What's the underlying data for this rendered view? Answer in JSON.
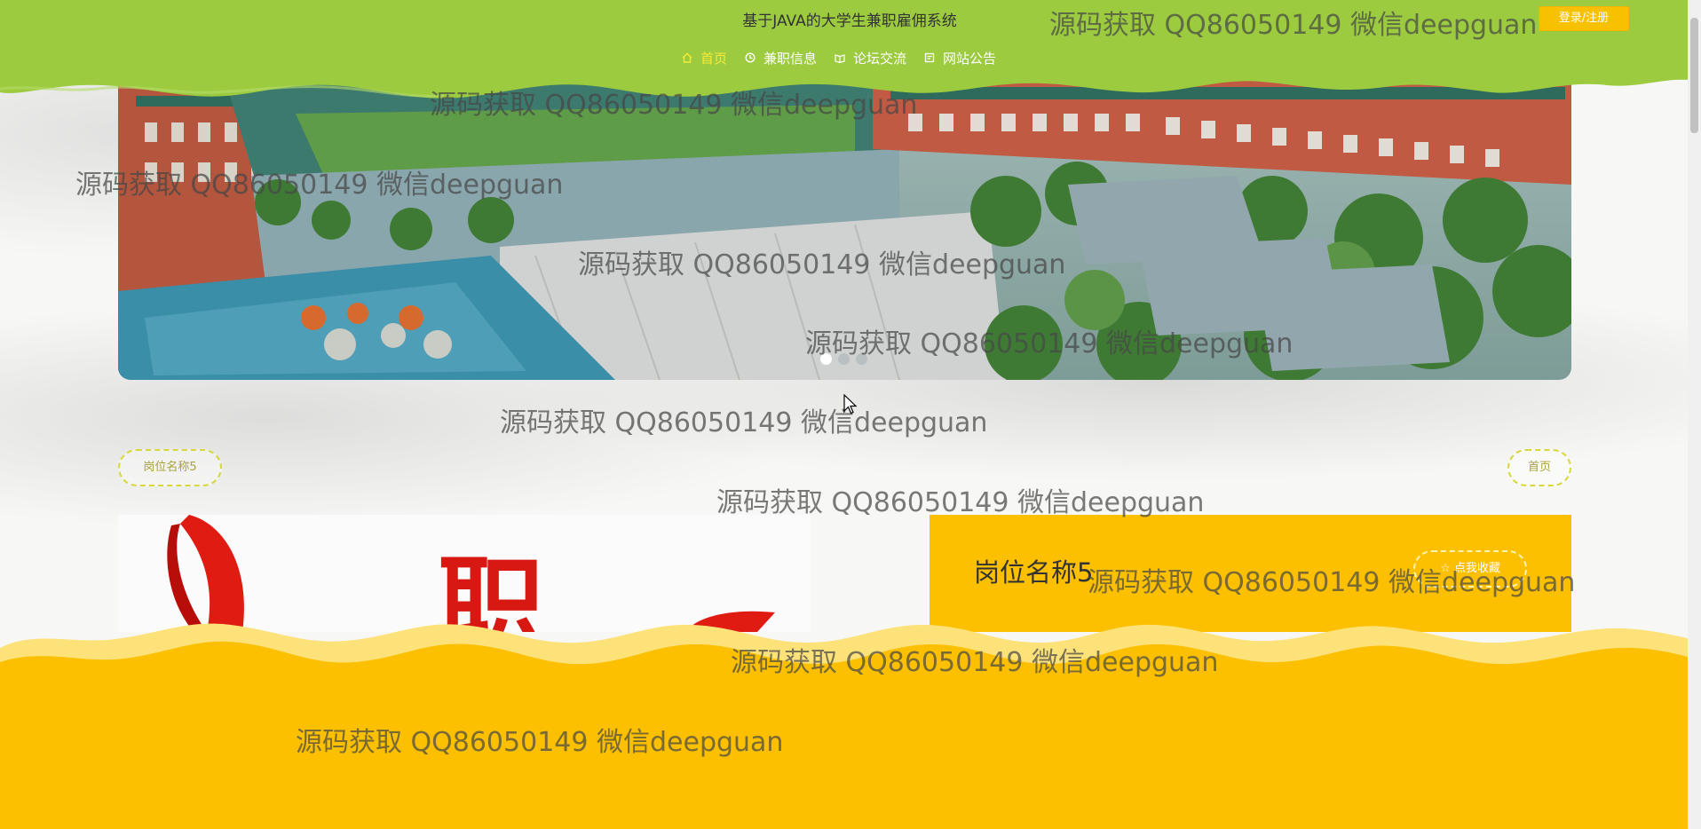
{
  "header": {
    "site_title": "基于JAVA的大学生兼职雇佣系统",
    "login_label": "登录/注册",
    "nav": [
      {
        "label": "首页",
        "icon": "home-icon",
        "active": true
      },
      {
        "label": "兼职信息",
        "icon": "clock-icon",
        "active": false
      },
      {
        "label": "论坛交流",
        "icon": "book-icon",
        "active": false
      },
      {
        "label": "网站公告",
        "icon": "notice-icon",
        "active": false
      }
    ]
  },
  "banner": {
    "dot_count": 3,
    "active_dot": 1
  },
  "breadcrumb": {
    "job_name": "岗位名称5",
    "home_label": "首页"
  },
  "detail": {
    "title": "岗位名称5",
    "favorite_label": "点我收藏",
    "image_text": "职"
  },
  "watermark": "源码获取 QQ86050149 微信deepguan",
  "colors": {
    "header_green": "#9ccb3f",
    "accent_yellow": "#fcc000",
    "nav_active": "#f6ea3a"
  }
}
